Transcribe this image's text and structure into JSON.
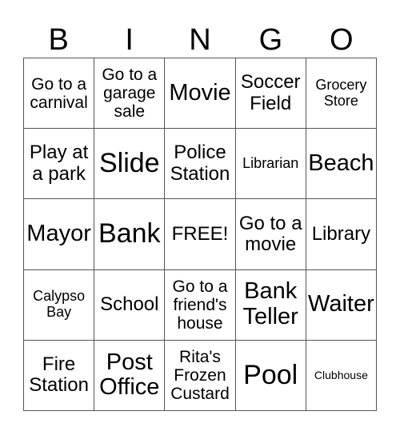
{
  "header": [
    "B",
    "I",
    "N",
    "G",
    "O"
  ],
  "rows": [
    [
      {
        "text": "Go to a\ncarnival",
        "size": "s-md"
      },
      {
        "text": "Go to a\ngarage\nsale",
        "size": "s-md"
      },
      {
        "text": "Movie",
        "size": "s-xl"
      },
      {
        "text": "Soccer\nField",
        "size": "s-lg"
      },
      {
        "text": "Grocery\nStore",
        "size": "s-sm"
      }
    ],
    [
      {
        "text": "Play at\na park",
        "size": "s-lg"
      },
      {
        "text": "Slide",
        "size": "s-xxl"
      },
      {
        "text": "Police\nStation",
        "size": "s-lg"
      },
      {
        "text": "Librarian",
        "size": "s-sm"
      },
      {
        "text": "Beach",
        "size": "s-xl"
      }
    ],
    [
      {
        "text": "Mayor",
        "size": "s-xl"
      },
      {
        "text": "Bank",
        "size": "s-xxl"
      },
      {
        "text": "FREE!",
        "size": "s-lg"
      },
      {
        "text": "Go to a\nmovie",
        "size": "s-lg"
      },
      {
        "text": "Library",
        "size": "s-lg"
      }
    ],
    [
      {
        "text": "Calypso\nBay",
        "size": "s-sm"
      },
      {
        "text": "School",
        "size": "s-lg"
      },
      {
        "text": "Go to a\nfriend's\nhouse",
        "size": "s-md"
      },
      {
        "text": "Bank\nTeller",
        "size": "s-xl"
      },
      {
        "text": "Waiter",
        "size": "s-xl"
      }
    ],
    [
      {
        "text": "Fire\nStation",
        "size": "s-lg"
      },
      {
        "text": "Post\nOffice",
        "size": "s-xl"
      },
      {
        "text": "Rita's\nFrozen\nCustard",
        "size": "s-md"
      },
      {
        "text": "Pool",
        "size": "s-xxl"
      },
      {
        "text": "Clubhouse",
        "size": "s-xs"
      }
    ]
  ]
}
